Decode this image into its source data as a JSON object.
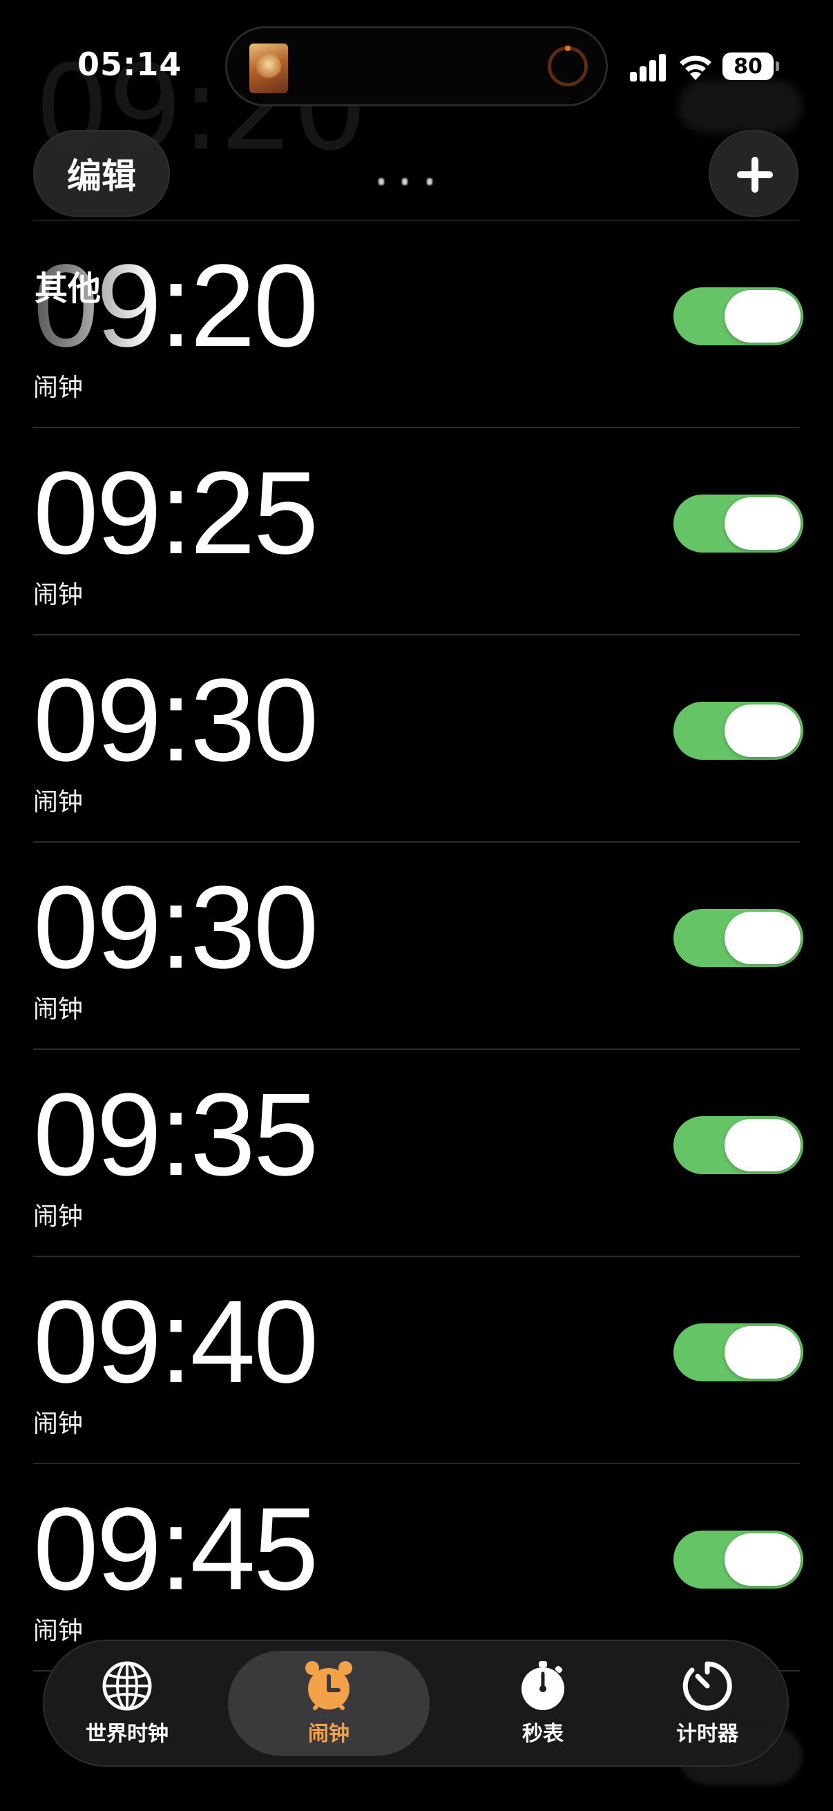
{
  "status_bar": {
    "time": "05:14",
    "battery": "80"
  },
  "header": {
    "edit_label": "编辑",
    "section_title": "其他"
  },
  "alarms": [
    {
      "time": "09:20",
      "label": "闹钟",
      "enabled": true
    },
    {
      "time": "09:25",
      "label": "闹钟",
      "enabled": true
    },
    {
      "time": "09:30",
      "label": "闹钟",
      "enabled": true
    },
    {
      "time": "09:30",
      "label": "闹钟",
      "enabled": true
    },
    {
      "time": "09:35",
      "label": "闹钟",
      "enabled": true
    },
    {
      "time": "09:40",
      "label": "闹钟",
      "enabled": true
    },
    {
      "time": "09:45",
      "label": "闹钟",
      "enabled": true
    }
  ],
  "tabs": [
    {
      "label": "世界时钟",
      "icon": "globe-icon",
      "active": false
    },
    {
      "label": "闹钟",
      "icon": "alarm-clock-icon",
      "active": true
    },
    {
      "label": "秒表",
      "icon": "stopwatch-icon",
      "active": false
    },
    {
      "label": "计时器",
      "icon": "timer-icon",
      "active": false
    }
  ],
  "colors": {
    "toggle_on": "#65c466",
    "tab_active": "#f4a24a",
    "background": "#000000"
  }
}
